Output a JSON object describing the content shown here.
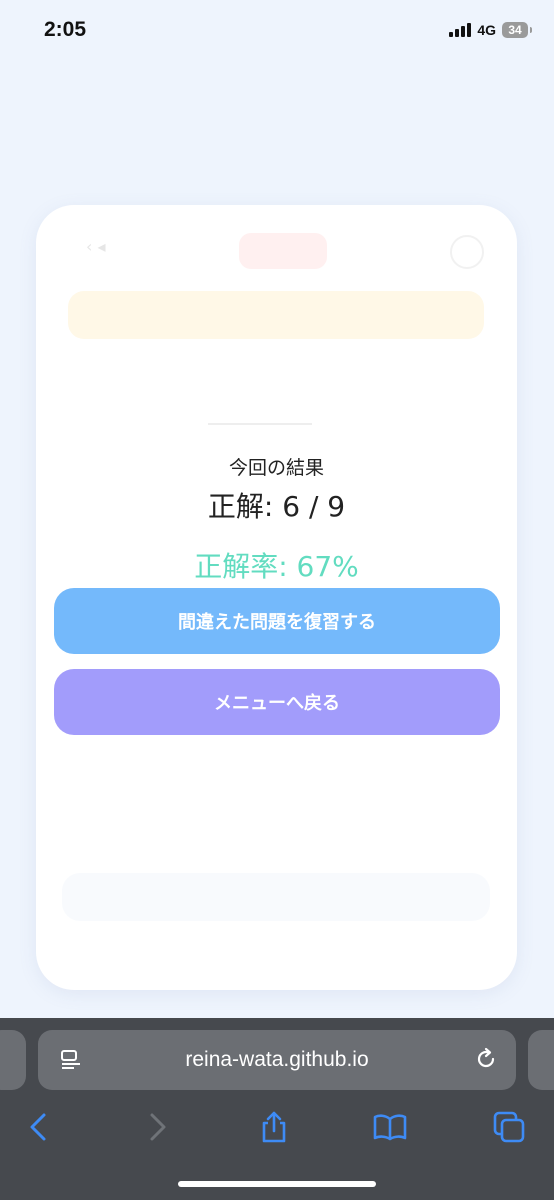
{
  "status_bar": {
    "time": "2:05",
    "network": "4G",
    "battery": "34"
  },
  "result": {
    "label": "今回の結果",
    "score": "正解: 6 / 9",
    "rate": "正解率: 67%"
  },
  "buttons": {
    "review": "間違えた問題を復習する",
    "menu": "メニューへ戻る"
  },
  "browser": {
    "url": "reina-wata.github.io"
  },
  "colors": {
    "accent_green": "#62dcc0",
    "review_button": "#74b9fb",
    "menu_button": "#a29cfb",
    "browser_blue": "#3e8bf5"
  }
}
